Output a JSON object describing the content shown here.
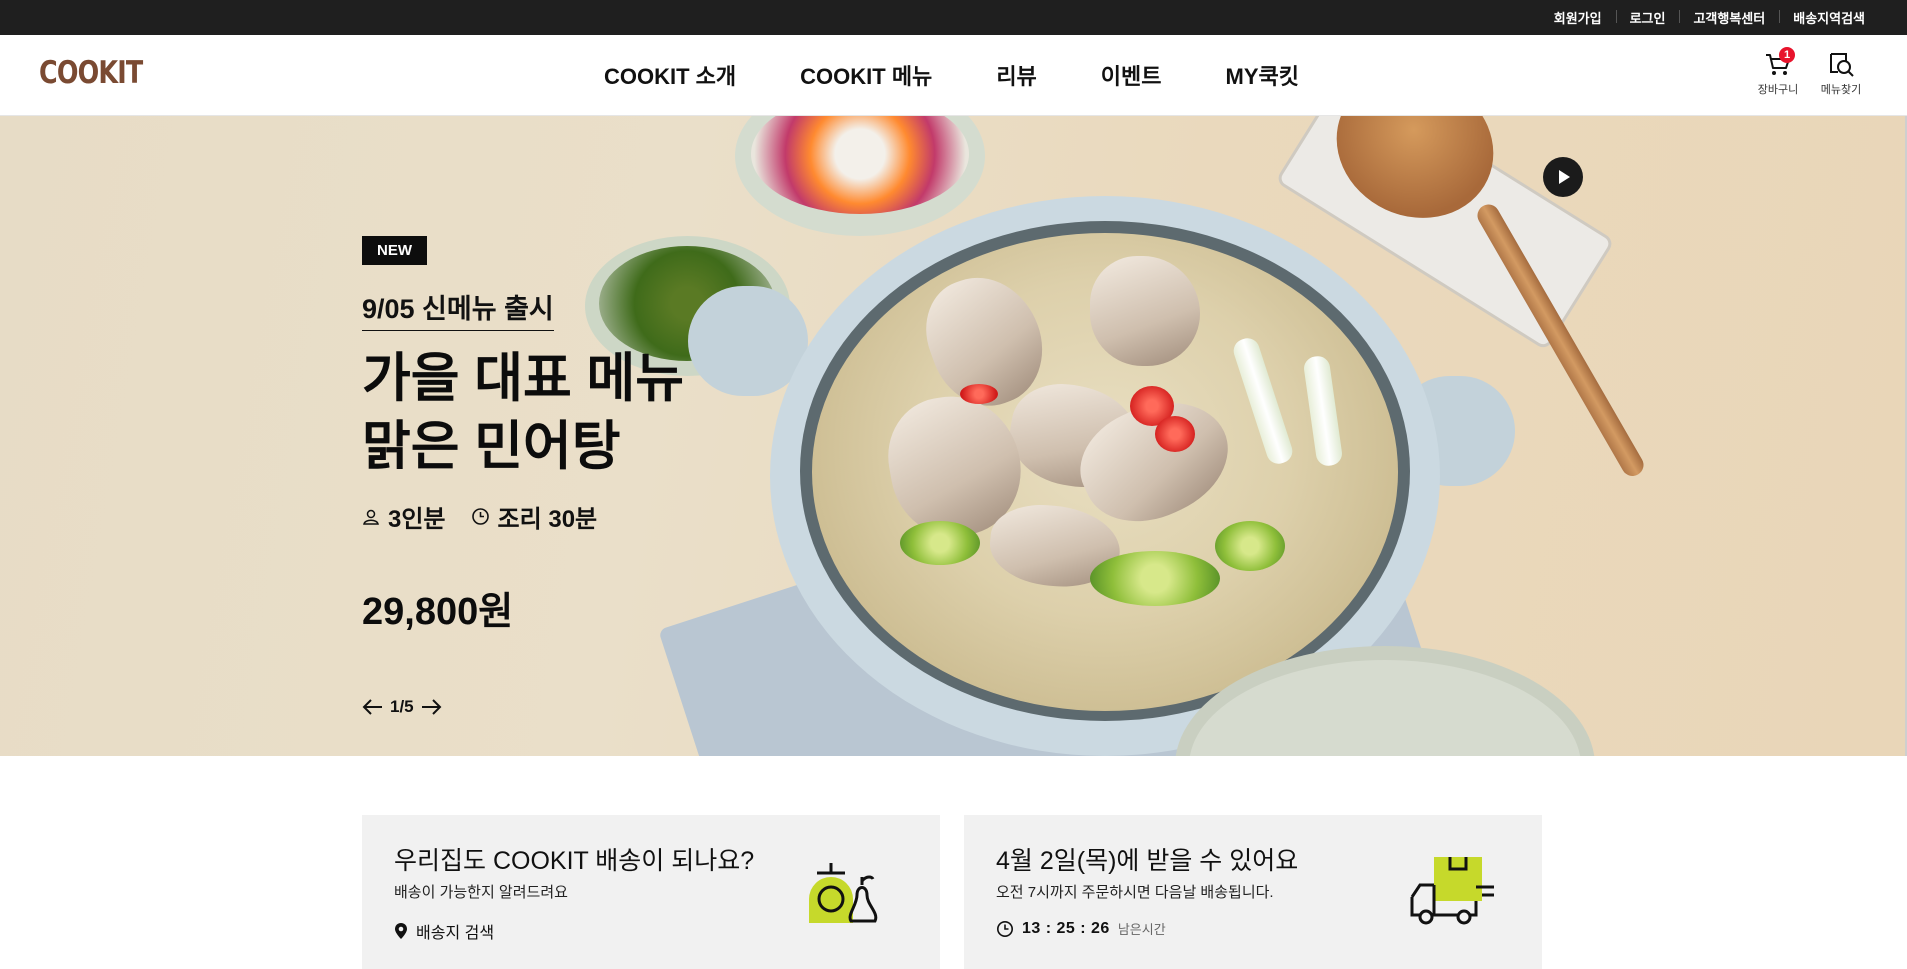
{
  "topbar": {
    "links": [
      "회원가입",
      "로그인",
      "고객행복센터",
      "배송지역검색"
    ]
  },
  "header": {
    "logo": "COOKIT",
    "nav": [
      "COOKIT 소개",
      "COOKIT 메뉴",
      "리뷰",
      "이벤트",
      "MY쿡킷"
    ],
    "cart_label": "장바구니",
    "cart_count": "1",
    "finder_label": "메뉴찾기",
    "icons": {
      "cart": "cart-icon",
      "finder": "menu-search-icon"
    }
  },
  "hero": {
    "tag": "NEW",
    "subtitle": "9/05 신메뉴 출시",
    "title_line1": "가을 대표 메뉴",
    "title_line2": "맑은 민어탕",
    "servings": "3인분",
    "cook_time": "조리 30분",
    "price": "29,800원",
    "pager": "1/5",
    "colors": {
      "tag_bg": "#0d0d0d"
    }
  },
  "cards": [
    {
      "title": "우리집도 COOKIT 배송이 되나요?",
      "desc": "배송이 가능한지 알려드려요",
      "action": "배송지 검색",
      "icon": "location-pin-icon"
    },
    {
      "title": "4월 2일(목)에 받을 수 있어요",
      "desc": "오전 7시까지 주문하시면 다음날 배송됩니다.",
      "timer": "13 : 25 : 26",
      "remain_label": "남은시간",
      "icon": "clock-icon"
    }
  ],
  "accent_color": "#c6d92b"
}
